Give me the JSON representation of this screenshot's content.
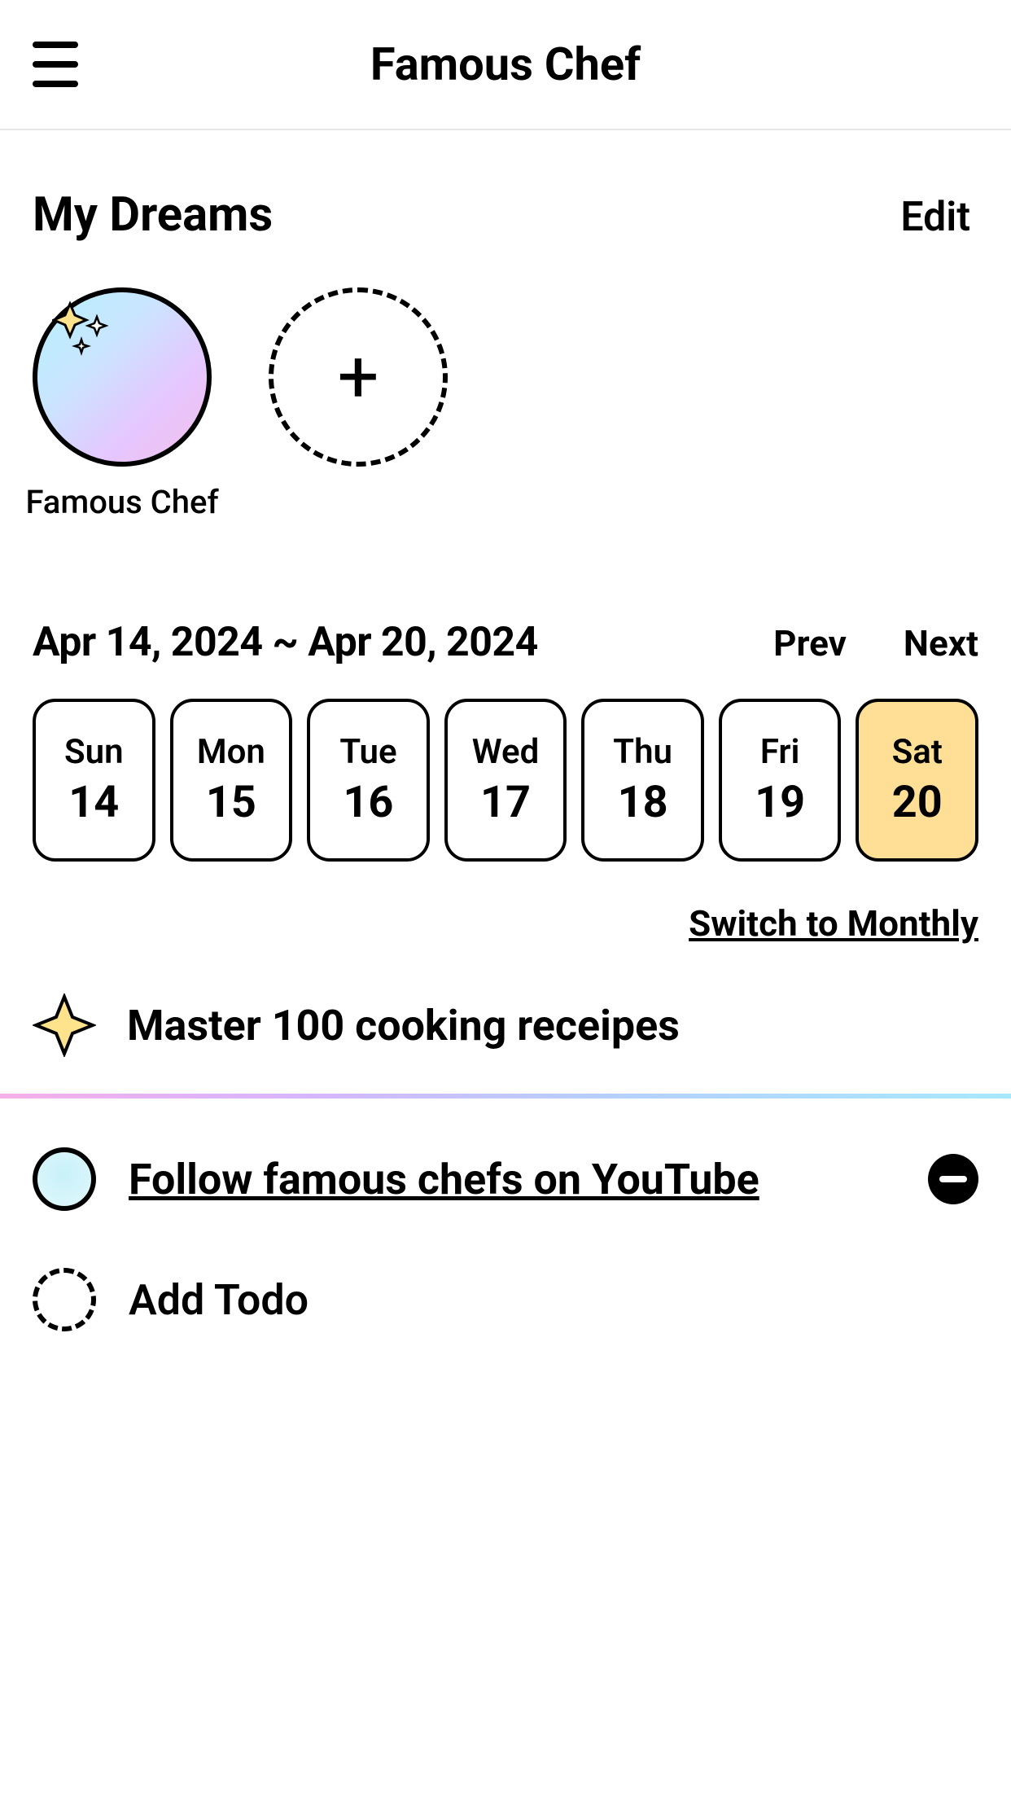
{
  "header": {
    "title": "Famous Chef"
  },
  "dreams": {
    "section_title": "My Dreams",
    "edit_label": "Edit",
    "items": [
      {
        "label": "Famous Chef"
      }
    ],
    "add_glyph": "+"
  },
  "calendar": {
    "range": "Apr 14, 2024 ~ Apr 20, 2024",
    "prev_label": "Prev",
    "next_label": "Next",
    "days": [
      {
        "name": "Sun",
        "num": "14",
        "selected": false
      },
      {
        "name": "Mon",
        "num": "15",
        "selected": false
      },
      {
        "name": "Tue",
        "num": "16",
        "selected": false
      },
      {
        "name": "Wed",
        "num": "17",
        "selected": false
      },
      {
        "name": "Thu",
        "num": "18",
        "selected": false
      },
      {
        "name": "Fri",
        "num": "19",
        "selected": false
      },
      {
        "name": "Sat",
        "num": "20",
        "selected": true
      }
    ],
    "switch_label": "Switch to Monthly"
  },
  "goal": {
    "text": "Master 100 cooking receipes"
  },
  "todos": {
    "items": [
      {
        "text": "Follow famous chefs on YouTube"
      }
    ],
    "add_label": "Add Todo"
  }
}
